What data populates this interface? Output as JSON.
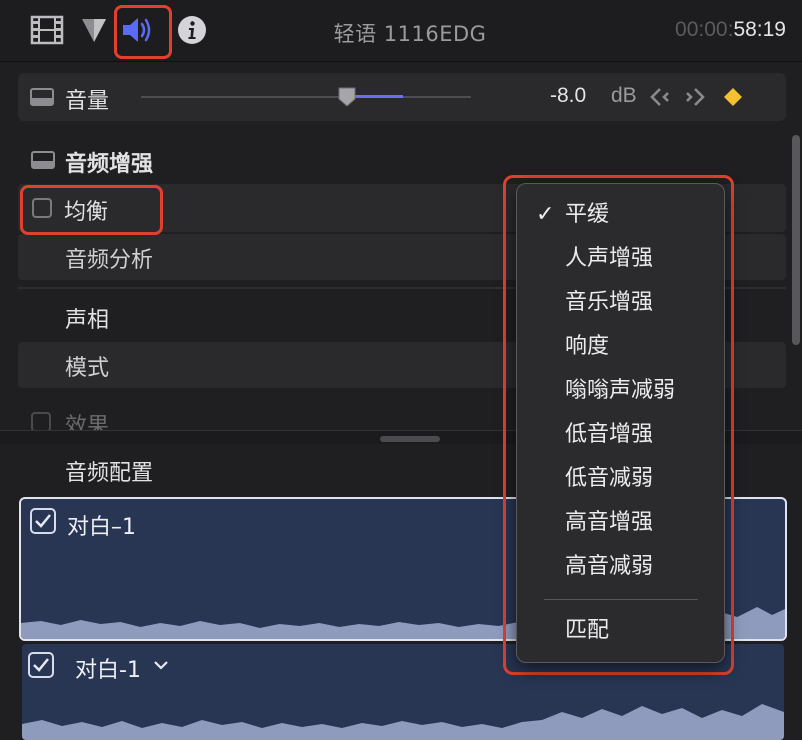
{
  "toolbar": {
    "clip_title": "轻语 1116EDG",
    "timecode_dim": "00:00:",
    "timecode_bright": "58:19"
  },
  "volume": {
    "label": "音量",
    "value": "-8.0",
    "unit": "dB",
    "slider_level": 0.62
  },
  "enhancements": {
    "title": "音频增强",
    "equalization_label": "均衡",
    "analysis_label": "音频分析"
  },
  "pan": {
    "title": "声相",
    "mode_label": "模式"
  },
  "effects": {
    "label": "效果"
  },
  "audio_config": {
    "title": "音频配置",
    "clips": [
      {
        "name": "对白–1",
        "checked": true
      },
      {
        "name": "对白-1",
        "checked": true
      }
    ]
  },
  "eq_menu": {
    "items": [
      {
        "label": "平缓",
        "checked": true
      },
      {
        "label": "人声增强",
        "checked": false
      },
      {
        "label": "音乐增强",
        "checked": false
      },
      {
        "label": "响度",
        "checked": false
      },
      {
        "label": "嗡嗡声减弱",
        "checked": false
      },
      {
        "label": "低音增强",
        "checked": false
      },
      {
        "label": "低音减弱",
        "checked": false
      },
      {
        "label": "高音增强",
        "checked": false
      },
      {
        "label": "高音减弱",
        "checked": false
      }
    ],
    "match_label": "匹配",
    "check_glyph": "✓"
  },
  "colors": {
    "highlight_outline": "#e0412f",
    "audio_icon_active": "#5a6cf3",
    "slider_fill": "#6d6ef5",
    "keyframe_add": "#f2c12e",
    "clip_bg": "#283553",
    "waveform": "#8e9bbd"
  },
  "icons": [
    "film-icon",
    "color-board-icon",
    "audio-icon",
    "info-icon",
    "keyframe-prev-icon",
    "keyframe-next-icon",
    "keyframe-add-icon"
  ]
}
